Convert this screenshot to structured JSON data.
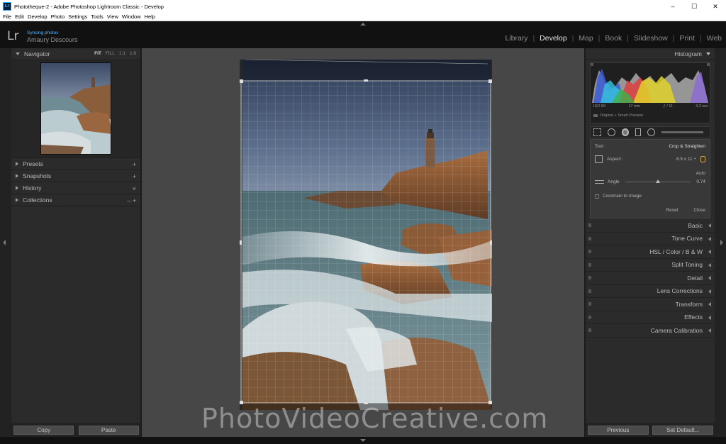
{
  "window": {
    "app_icon": "Lr",
    "title": "Phototheque-2 - Adobe Photoshop Lightroom Classic - Develop",
    "controls": [
      "–",
      "☐",
      "✕"
    ]
  },
  "menu": [
    "File",
    "Edit",
    "Develop",
    "Photo",
    "Settings",
    "Tools",
    "View",
    "Window",
    "Help"
  ],
  "identity": {
    "logo": "Lr",
    "sync_status": "Syncing photos",
    "user": "Amaury Descours"
  },
  "modules": [
    {
      "label": "Library",
      "active": false
    },
    {
      "label": "Develop",
      "active": true
    },
    {
      "label": "Map",
      "active": false
    },
    {
      "label": "Book",
      "active": false
    },
    {
      "label": "Slideshow",
      "active": false
    },
    {
      "label": "Print",
      "active": false
    },
    {
      "label": "Web",
      "active": false
    }
  ],
  "left_panel": {
    "navigator": {
      "label": "Navigator",
      "zoom": [
        "FIT",
        "FILL",
        "1:1",
        "1:8"
      ],
      "zoom_active": "FIT"
    },
    "sections": [
      {
        "label": "Presets",
        "action": "+"
      },
      {
        "label": "Snapshots",
        "action": "+"
      },
      {
        "label": "History",
        "action": "×"
      },
      {
        "label": "Collections",
        "action": "– +"
      }
    ],
    "buttons": {
      "copy": "Copy",
      "paste": "Paste"
    }
  },
  "right_panel": {
    "histogram": {
      "label": "Histogram",
      "iso": "ISO 50",
      "focal": "17 mm",
      "aperture": "ƒ / 11",
      "shutter": "3.2 sec",
      "preview": "Original + Smart Preview"
    },
    "crop": {
      "tool_label": "Tool :",
      "tool_name": "Crop & Straighten",
      "aspect_label": "Aspect :",
      "aspect_value": "8.5 x 11 ÷",
      "auto_label": "Auto",
      "angle_label": "Angle",
      "angle_value": "0.74",
      "angle_fraction": 0.5,
      "constrain_label": "Constrain to Image",
      "reset": "Reset",
      "close": "Close"
    },
    "sections": [
      {
        "label": "Basic"
      },
      {
        "label": "Tone Curve"
      },
      {
        "label": "HSL   /   Color   /   B & W"
      },
      {
        "label": "Split Toning"
      },
      {
        "label": "Detail"
      },
      {
        "label": "Lens Corrections"
      },
      {
        "label": "Transform"
      },
      {
        "label": "Effects"
      },
      {
        "label": "Camera Calibration"
      }
    ],
    "buttons": {
      "previous": "Previous",
      "set_default": "Set Default..."
    }
  },
  "watermark": "PhotoVideoCreative.com"
}
